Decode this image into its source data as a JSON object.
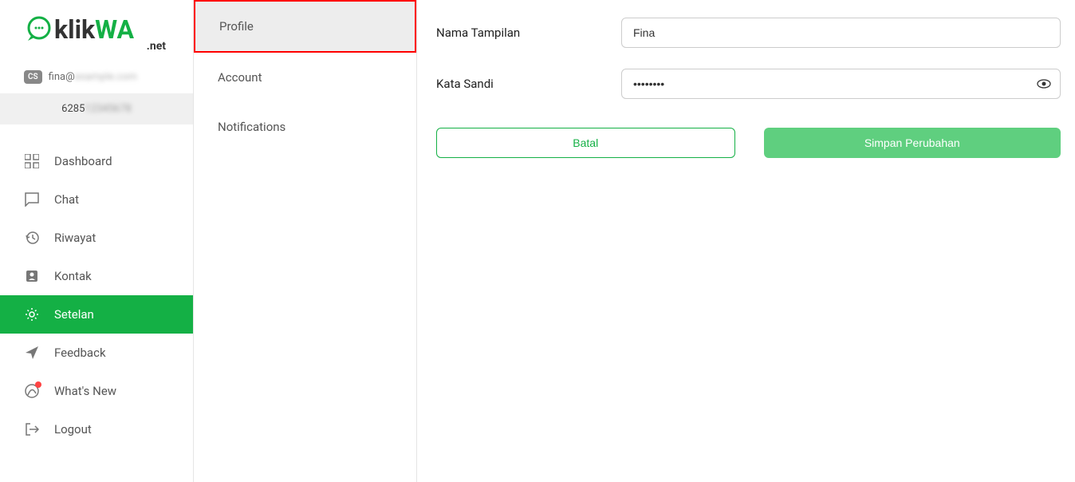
{
  "logo": {
    "text1": "klik",
    "text2": "WA",
    "suffix": ".net"
  },
  "user": {
    "badge": "CS",
    "email_prefix": "fina@",
    "email_rest": "example.com",
    "phone_prefix": "6285",
    "phone_rest": "12345678"
  },
  "nav": {
    "dashboard": "Dashboard",
    "chat": "Chat",
    "riwayat": "Riwayat",
    "kontak": "Kontak",
    "setelan": "Setelan",
    "feedback": "Feedback",
    "whatsnew": "What's New",
    "logout": "Logout"
  },
  "subnav": {
    "profile": "Profile",
    "account": "Account",
    "notifications": "Notifications"
  },
  "form": {
    "display_name_label": "Nama Tampilan",
    "display_name_value": "Fina",
    "password_label": "Kata Sandi",
    "password_value": "••••••••",
    "cancel": "Batal",
    "save": "Simpan Perubahan"
  }
}
